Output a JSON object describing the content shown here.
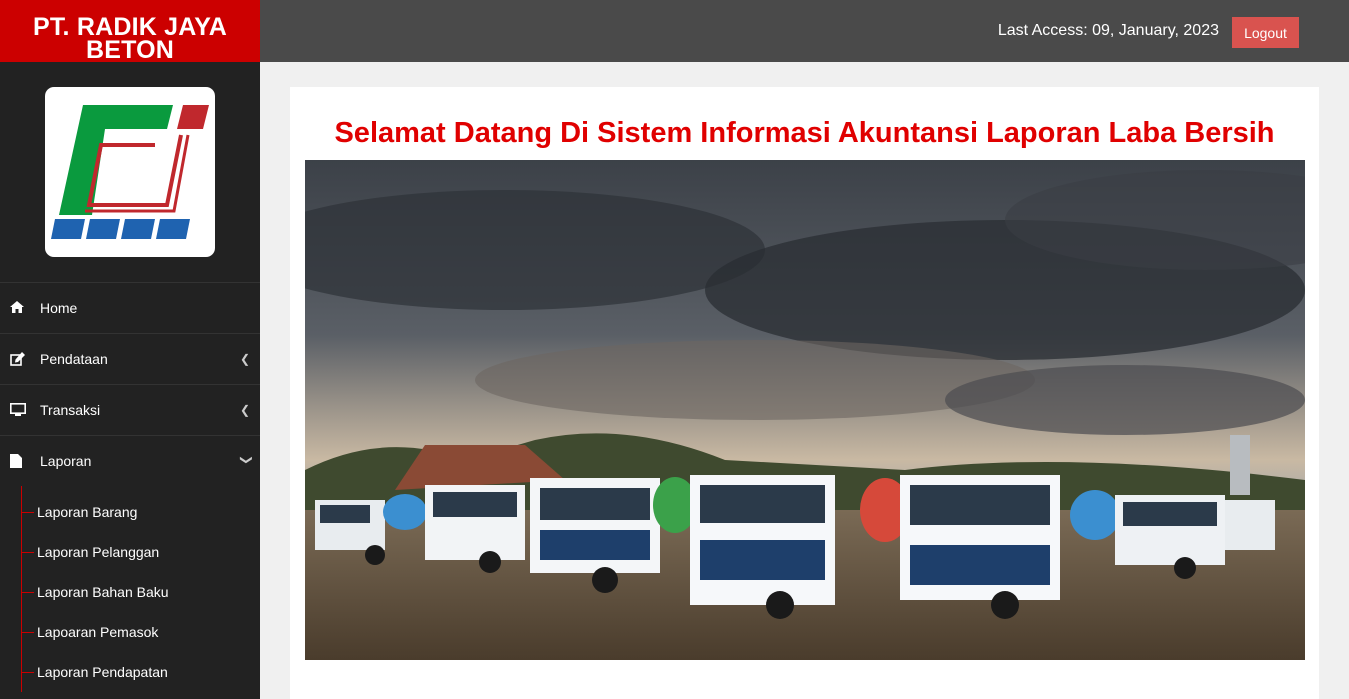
{
  "brand": {
    "line1": "PT. RADIK JAYA",
    "line2": "BETON"
  },
  "header": {
    "last_access": "Last Access: 09, January, 2023",
    "logout_label": "Logout"
  },
  "sidebar": {
    "items": [
      {
        "label": "Home",
        "icon": "home-icon"
      },
      {
        "label": "Pendataan",
        "icon": "edit-icon"
      },
      {
        "label": "Transaksi",
        "icon": "monitor-icon"
      },
      {
        "label": "Laporan",
        "icon": "file-icon"
      }
    ],
    "laporan_sub": [
      "Laporan Barang",
      "Laporan Pelanggan",
      "Laporan Bahan Baku",
      "Lapoaran Pemasok",
      "Laporan Pendapatan"
    ]
  },
  "main": {
    "welcome": "Selamat Datang Di Sistem Informasi Akuntansi Laporan Laba Bersih"
  },
  "colors": {
    "brand_red": "#cc0000",
    "sidebar_bg": "#222222",
    "topbar_bg": "#4a4a4a",
    "logout_bg": "#d9534f",
    "title_red": "#e00000"
  }
}
